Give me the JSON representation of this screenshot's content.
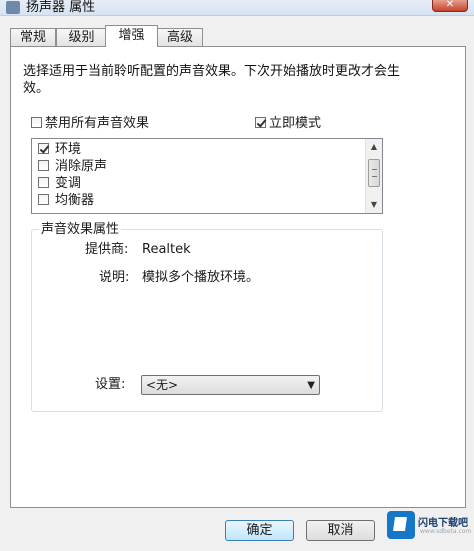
{
  "window": {
    "title": "扬声器 属性",
    "close_glyph": "✕"
  },
  "tabs": [
    {
      "label": "常规",
      "active": false
    },
    {
      "label": "级别",
      "active": false
    },
    {
      "label": "增强",
      "active": true
    },
    {
      "label": "高级",
      "active": false
    }
  ],
  "description": "选择适用于当前聆听配置的声音效果。下次开始播放时更改才会生效。",
  "disable_all": {
    "label": "禁用所有声音效果",
    "checked": false
  },
  "immediate_mode": {
    "label": "立即模式",
    "checked": true
  },
  "effects": [
    {
      "label": "环境",
      "checked": true
    },
    {
      "label": "消除原声",
      "checked": false
    },
    {
      "label": "变调",
      "checked": false
    },
    {
      "label": "均衡器",
      "checked": false
    }
  ],
  "properties": {
    "legend": "声音效果属性",
    "provider_label": "提供商:",
    "provider_value": "Realtek",
    "desc_label": "说明:",
    "desc_value": "模拟多个播放环境。",
    "setting_label": "设置:",
    "setting_value": "<无>"
  },
  "buttons": {
    "ok": "确定",
    "cancel": "取消"
  },
  "watermark": {
    "text": "闪电下载吧",
    "sub": "www.sdbeta.com"
  },
  "icons": {
    "scroll_up": "▲",
    "scroll_down": "▼",
    "dropdown": "▼"
  },
  "colors": {
    "default_button": "#bee6fd",
    "panel": "#ffffff",
    "window": "#f0f0f0"
  }
}
